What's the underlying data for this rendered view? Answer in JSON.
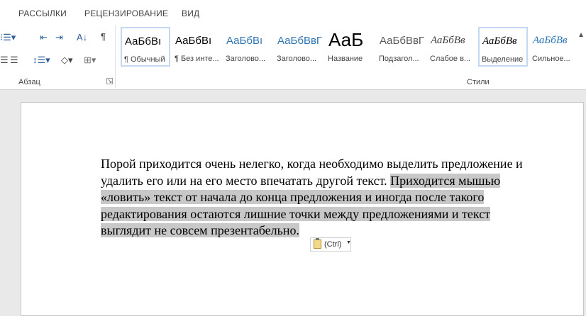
{
  "ribbon": {
    "tabs": [
      "РАССЫЛКИ",
      "РЕЦЕНЗИРОВАНИЕ",
      "ВИД"
    ],
    "groups": {
      "paragraph": "Абзац",
      "styles": "Стили"
    },
    "styles": [
      {
        "preview": "АаБбВı",
        "name": "¶ Обычный",
        "selected": true,
        "color": "#000000",
        "font_style": "normal"
      },
      {
        "preview": "АаБбВı",
        "name": "¶ Без инте...",
        "selected": false,
        "color": "#000000",
        "font_style": "normal"
      },
      {
        "preview": "АаБбВı",
        "name": "Заголово...",
        "selected": false,
        "color": "#2e74b5",
        "font_style": "normal"
      },
      {
        "preview": "АаБбВвГ",
        "name": "Заголово...",
        "selected": false,
        "color": "#2e74b5",
        "font_style": "normal"
      },
      {
        "preview": "АаБ",
        "name": "Название",
        "selected": false,
        "color": "#000000",
        "font_style": "large"
      },
      {
        "preview": "АаБбВвГ",
        "name": "Подзагол...",
        "selected": false,
        "color": "#595959",
        "font_style": "normal"
      },
      {
        "preview": "АаБбВв",
        "name": "Слабое в...",
        "selected": false,
        "color": "#404040",
        "font_style": "italic"
      },
      {
        "preview": "АаБбВв",
        "name": "Выделение",
        "selected": true,
        "color": "#000000",
        "font_style": "italic"
      },
      {
        "preview": "АаБбВв",
        "name": "Сильное...",
        "selected": false,
        "color": "#2e74b5",
        "font_style": "italic"
      }
    ]
  },
  "document": {
    "plain_text": "Порой приходится очень нелегко, когда необходимо выделить предложение и удалить его или на его место впечатать другой текст. ",
    "selected_text": "Приходится мышью «ловить» текст от начала до конца предложения и иногда после такого редактирования остаются лишние точки между предложениями и текст выглядит не совсем презентабельно."
  },
  "paste_options": {
    "label": "(Ctrl)"
  }
}
